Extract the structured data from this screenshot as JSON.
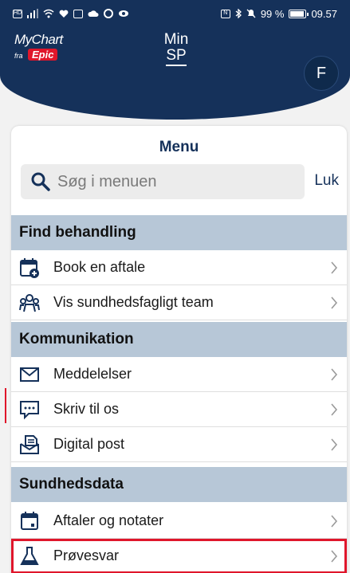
{
  "status_bar": {
    "battery_percent": "99 %",
    "time": "09.57"
  },
  "app": {
    "logo_name": "MyChart",
    "logo_fra": "fra",
    "logo_epic": "Epic",
    "context_line1": "Min",
    "context_line2": "SP",
    "avatar_initial": "F"
  },
  "menu": {
    "title": "Menu",
    "search_placeholder": "Søg i menuen",
    "close_label": "Luk",
    "sections": [
      {
        "title": "Find behandling",
        "items": [
          {
            "label": "Book en aftale",
            "icon": "calendar-add-icon"
          },
          {
            "label": "Vis sundhedsfagligt team",
            "icon": "team-icon"
          }
        ]
      },
      {
        "title": "Kommunikation",
        "items": [
          {
            "label": "Meddelelser",
            "icon": "envelope-icon"
          },
          {
            "label": "Skriv til os",
            "icon": "chat-icon"
          },
          {
            "label": "Digital post",
            "icon": "digital-post-icon"
          }
        ]
      },
      {
        "title": "Sundhedsdata",
        "items": [
          {
            "label": "Aftaler og notater",
            "icon": "calendar-icon"
          },
          {
            "label": "Prøvesvar",
            "icon": "flask-icon"
          }
        ]
      }
    ]
  },
  "colors": {
    "brand_navy": "#15315a",
    "section_bg": "#b7c7d7",
    "highlight_red": "#e0162b"
  }
}
